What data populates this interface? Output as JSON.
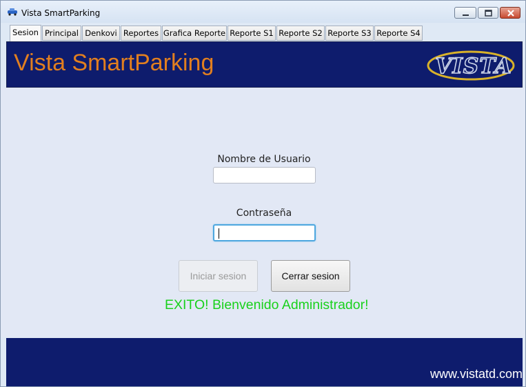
{
  "window": {
    "title": "Vista SmartParking",
    "controls": [
      "minimize",
      "maximize",
      "close"
    ]
  },
  "tabs": [
    {
      "label": "Sesion",
      "active": true
    },
    {
      "label": "Principal",
      "active": false
    },
    {
      "label": "Denkovi",
      "active": false
    },
    {
      "label": "Reportes",
      "active": false
    },
    {
      "label": "Grafica Reporte",
      "active": false
    },
    {
      "label": "Reporte S1",
      "active": false
    },
    {
      "label": "Reporte S2",
      "active": false
    },
    {
      "label": "Reporte S3",
      "active": false
    },
    {
      "label": "Reporte S4",
      "active": false
    }
  ],
  "header": {
    "title": "Vista SmartParking",
    "logo_text": "VISTA"
  },
  "login": {
    "username_label": "Nombre de Usuario",
    "username_value": "",
    "password_label": "Contraseña",
    "password_value": "",
    "login_button": "Iniciar sesion",
    "login_enabled": false,
    "logout_button": "Cerrar sesion",
    "status_message": "EXITO! Bienvenido Administrador!"
  },
  "footer": {
    "url": "www.vistatd.com"
  },
  "colors": {
    "header_bg": "#0e1c6d",
    "title_orange": "#e27f1f",
    "success_green": "#19d11c",
    "content_bg": "#e2e8f5"
  }
}
